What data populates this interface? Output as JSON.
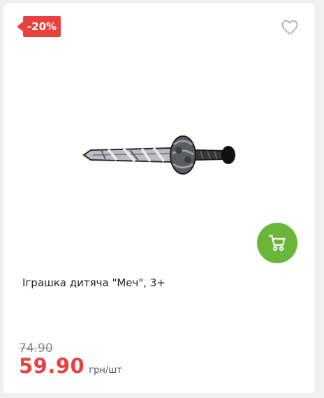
{
  "product": {
    "discount_badge": "-20%",
    "title": "Іграшка дитяча \"Меч\", 3+",
    "old_price": "74.90",
    "current_price": "59.90",
    "price_unit": "грн/шт",
    "image_icon": "toy-sword-image"
  },
  "actions": {
    "favorite_icon": "heart-outline-icon",
    "cart_icon": "shopping-cart-icon"
  },
  "colors": {
    "badge": "#e8423f",
    "price": "#e8423f",
    "cart_button": "#6ab638"
  }
}
